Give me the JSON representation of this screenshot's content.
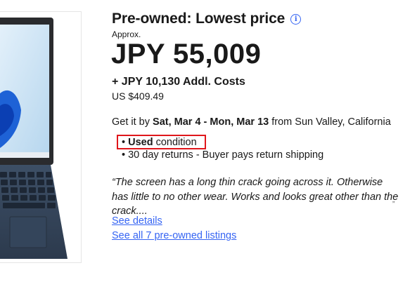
{
  "header": {
    "title": "Pre-owned: Lowest price",
    "info_icon": "info-icon"
  },
  "price": {
    "approx_label": "Approx.",
    "amount": "JPY 55,009",
    "additional_costs": "+ JPY 10,130 Addl. Costs",
    "usd": "US $409.49"
  },
  "delivery": {
    "prefix": "Get it by",
    "dates": "Sat, Mar 4 - Mon, Mar 13",
    "suffix": "from Sun Valley, California"
  },
  "condition": {
    "bullet": "•",
    "label_bold": "Used",
    "label_rest": "condition",
    "highlight_color": "#e0161b"
  },
  "returns": {
    "text": "• 30 day returns - Buyer pays return shipping"
  },
  "seller_note": {
    "text": "“The screen has a long thin crack going across it. Otherwise has little to no other wear. Works and looks great other than the crack....",
    "closing_mark": "”"
  },
  "links": {
    "see_details": "See details",
    "see_all": "See all 7 pre-owned listings"
  },
  "colors": {
    "link": "#3665f3",
    "text": "#191919"
  }
}
